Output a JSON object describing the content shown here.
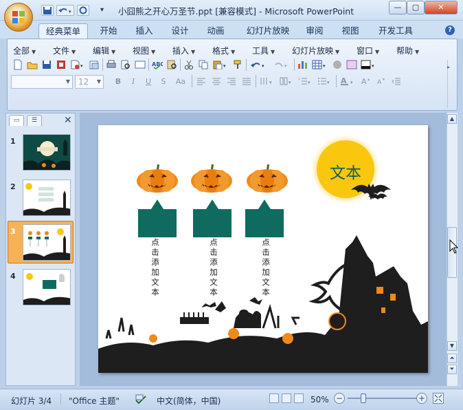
{
  "window": {
    "title": "小囧熊之开心万圣节.ppt [兼容模式] - Microsoft PowerPoint",
    "icons": [
      "office-button",
      "save-icon",
      "undo-icon",
      "redo-icon",
      "customize-qat-icon",
      "minimize-icon",
      "maximize-icon",
      "close-icon"
    ]
  },
  "tabs": [
    {
      "label": "经典菜单",
      "active": true
    },
    {
      "label": "开始"
    },
    {
      "label": "插入"
    },
    {
      "label": "设计"
    },
    {
      "label": "动画"
    },
    {
      "label": "幻灯片放映"
    },
    {
      "label": "审阅"
    },
    {
      "label": "视图"
    },
    {
      "label": "开发工具"
    }
  ],
  "menu": [
    "全部",
    "文件",
    "编辑",
    "视图",
    "插入",
    "格式",
    "工具",
    "幻灯片放映",
    "窗口",
    "帮助"
  ],
  "format": {
    "font_name": "",
    "font_size": "12",
    "bold": "B",
    "italic": "I",
    "underline": "U",
    "strike": "S",
    "case": "Aa"
  },
  "pane": {
    "slides": [
      {
        "num": "1"
      },
      {
        "num": "2"
      },
      {
        "num": "3",
        "selected": true
      },
      {
        "num": "4"
      }
    ]
  },
  "slide": {
    "title_circle": "文本",
    "columns": [
      "点击添加文本",
      "点击添加文本",
      "点击添加文本"
    ],
    "colors": {
      "accent": "#0f6b5f",
      "circle": "#f9c80e",
      "pumpkin": "#f08a1a",
      "silhouette": "#1e1e1e"
    }
  },
  "status": {
    "slide_index": "幻灯片 3/4",
    "theme": "\"Office 主题\"",
    "language": "中文(简体，中国)",
    "zoom": "50%",
    "zoom_value": 50
  }
}
